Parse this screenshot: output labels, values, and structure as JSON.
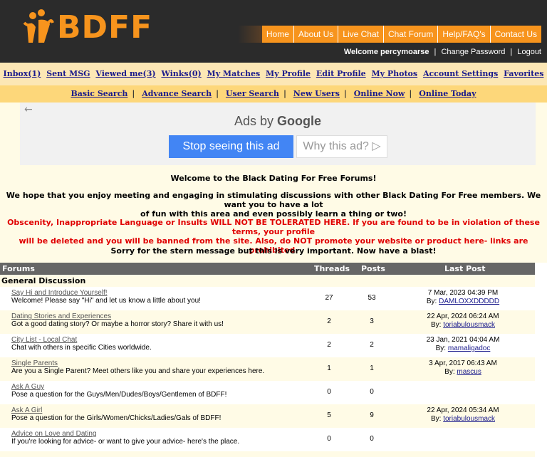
{
  "header": {
    "logo_text": "BDFF",
    "nav": [
      "Home",
      "About Us",
      "Live Chat",
      "Chat Forum",
      "Help/FAQ's",
      "Contact Us"
    ],
    "welcome_label": "Welcome percymoarse",
    "change_password": "Change Password",
    "logout": "Logout",
    "separator": "|"
  },
  "subnav1": [
    "Inbox(1)",
    "Sent MSG",
    "Viewed me(3)",
    "Winks(0)",
    "My Matches",
    "My Profile",
    "Edit Profile",
    "My Photos",
    "Account Settings",
    "Favorites"
  ],
  "subnav2": [
    "Basic Search",
    "Advance Search",
    "User Search",
    "New Users",
    "Online Now",
    "Online Today"
  ],
  "ad": {
    "back": "←",
    "title_prefix": "Ads by",
    "title_brand": "Google",
    "stop": "Stop seeing this ad",
    "why": "Why this ad? ▷"
  },
  "messages": {
    "welcome": "Welcome to the Black Dating For Free Forums!",
    "intro_1": "We hope that you enjoy meeting and engaging in stimulating discussions with other Black Dating For Free members. We want you to have a lot",
    "intro_2": "of fun with this area and even possibly learn a thing or two!",
    "warning_1": "Obscenity, Inappropriate Language or Insults WILL NOT BE TOLERATED HERE. If you are found to be in violation of these terms, your profile",
    "warning_2": "will be deleted and you will be banned from the site. Also, do NOT promote your website or product here- links are prohibited.",
    "sorry": "Sorry for the stern message but this is very important. Now have a blast!"
  },
  "table": {
    "headers": {
      "forums": "Forums",
      "threads": "Threads",
      "posts": "Posts",
      "last_post": "Last Post"
    },
    "category": "General Discussion",
    "rows": [
      {
        "title": "Say Hi and Introduce Yourself!",
        "desc": "Welcome! Please say \"Hi\" and let us know a little about you!",
        "threads": "27",
        "posts": "53",
        "date": "7 Mar, 2023 04:39 PM",
        "by": "By:",
        "user": "DAMLOXXDDDDD"
      },
      {
        "title": "Dating Stories and Experiences",
        "desc": "Got a good dating story? Or maybe a horror story? Share it with us!",
        "threads": "2",
        "posts": "3",
        "date": "22 Apr, 2024 06:24 AM",
        "by": "By:",
        "user": "toriabulousmack"
      },
      {
        "title": "City List - Local Chat",
        "desc": "Chat with others in specific Cities worldwide.",
        "threads": "2",
        "posts": "2",
        "date": "23 Jan, 2021 04:04 AM",
        "by": "By:",
        "user": "mamaligadoc"
      },
      {
        "title": "Single Parents",
        "desc": "Are you a Single Parent? Meet others like you and share your experiences here.",
        "threads": "1",
        "posts": "1",
        "date": "3 Apr, 2017 06:43 AM",
        "by": "By:",
        "user": "mascus"
      },
      {
        "title": "Ask A Guy",
        "desc": "Pose a question for the Guys/Men/Dudes/Boys/Gentlemen of BDFF!",
        "threads": "0",
        "posts": "0",
        "date": "",
        "by": "",
        "user": ""
      },
      {
        "title": "Ask A Girl",
        "desc": "Pose a question for the Girls/Women/Chicks/Ladies/Gals of BDFF!",
        "threads": "5",
        "posts": "9",
        "date": "22 Apr, 2024 05:34 AM",
        "by": "By:",
        "user": "toriabulousmack"
      },
      {
        "title": "Advice on Love and Dating",
        "desc": "If you're looking for advice- or want to give your advice- here's the place.",
        "threads": "0",
        "posts": "0",
        "date": "",
        "by": "",
        "user": ""
      }
    ]
  },
  "colors": {
    "brand_orange": "#f7941d",
    "header_dark": "#2b2b2b",
    "warning_red": "#e00000",
    "link_blue": "#1a1a8c"
  }
}
